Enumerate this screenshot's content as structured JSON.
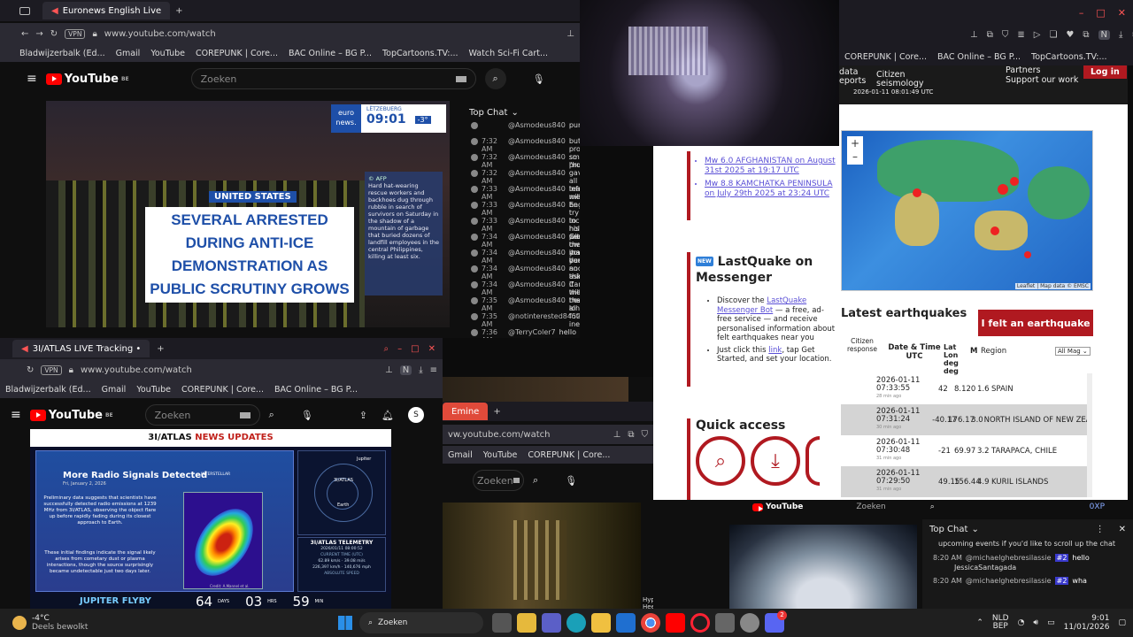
{
  "top_browser": {
    "tab_title": "Euronews English Live",
    "url": "www.youtube.com/watch",
    "vpn": "VPN",
    "bookmarks": [
      "Bladwijzerbalk (Ed...",
      "Gmail",
      "YouTube",
      "COREPUNK | Core...",
      "BAC Online – BG P...",
      "TopCartoons.TV:...",
      "Watch Sci-Fi Cart..."
    ],
    "yt_logo": "YouTube",
    "yt_region": "BE",
    "search_placeholder": "Zoeken"
  },
  "video_main": {
    "brand_top": "euro",
    "brand_bottom": "news.",
    "city": "LËTZEBUERG",
    "time": "09:01",
    "temp": "-3°",
    "tag": "UNITED STATES",
    "headline": "SEVERAL ARRESTED DURING ANTI-ICE DEMONSTRATION AS PUBLIC SCRUTINY GROWS",
    "side_source": "© AFP",
    "side_text": "Hard hat-wearing rescue workers and backhoes dug through rubble in search of survivors on Saturday in the shadow of a mountain of garbage that buried dozens of landfill employees in the central Philippines, killing at least six."
  },
  "chat_top": {
    "title": "Top Chat",
    "rows": [
      {
        "t": "",
        "u": "@Asmodeus840",
        "m": "purpose"
      },
      {
        "t": "7:32 AM",
        "u": "@Asmodeus840",
        "m": "but for problem so better \"humans\""
      },
      {
        "t": "7:32 AM",
        "u": "@Asmodeus840",
        "m": "smart problems"
      },
      {
        "t": "7:32 AM",
        "u": "@Asmodeus840",
        "m": "gave all info, will b"
      },
      {
        "t": "7:33 AM",
        "u": "@Asmodeus840",
        "m": "teach me English"
      },
      {
        "t": "7:33 AM",
        "u": "@Asmodeus840",
        "m": "he try to hold Cana"
      },
      {
        "t": "7:33 AM",
        "u": "@Asmodeus840",
        "m": "increase his presen there a make a deal"
      },
      {
        "t": "7:34 AM",
        "u": "@Asmodeus840",
        "m": "with owneing it as of you"
      },
      {
        "t": "7:34 AM",
        "u": "@Asmodeus840",
        "m": "you are humans no think"
      },
      {
        "t": "7:34 AM",
        "u": "@Asmodeus840",
        "m": "and ask if there ne"
      },
      {
        "t": "7:34 AM",
        "u": "@Asmodeus840",
        "m": "Canada will be the very long future it's inevitable"
      },
      {
        "t": "7:35 AM",
        "u": "@Asmodeus840",
        "m": "that's all"
      },
      {
        "t": "7:35 AM",
        "u": "@notinterested8452",
        "m": "USA gone rogu"
      },
      {
        "t": "7:36 AM",
        "u": "@TerryColer7",
        "m": "hello"
      }
    ]
  },
  "emsc": {
    "header_items": [
      "data",
      "Citizen",
      "seismology",
      "eports",
      "Partners",
      "Support our work"
    ],
    "header_time": "2026-01-11 08:01:49 UTC",
    "login": "Log in",
    "map_attribution": "Leaflet | Map data © EMSC",
    "zoom_in": "+",
    "zoom_out": "–",
    "latest_title": "Latest earthquakes",
    "felt_button": "I felt an earthquake",
    "col_citizen": "Citizen response",
    "col_date": "Date & Time UTC",
    "col_latlon": "Lat Lon deg deg",
    "col_mag": "M",
    "col_region": "Region",
    "filter": "All Mag",
    "rows": [
      {
        "date": "2026-01-11",
        "time": "07:33:55",
        "ago": "28 min ago",
        "lat": "42",
        "lon": "8.120",
        "mag": "1.6",
        "region": "SPAIN"
      },
      {
        "date": "2026-01-11",
        "time": "07:31:24",
        "ago": "30 min ago",
        "lat": "-40.17",
        "lon": "176.17",
        "mag": "3.0",
        "region": "NORTH ISLAND OF NEW ZEA..."
      },
      {
        "date": "2026-01-11",
        "time": "07:30:48",
        "ago": "31 min ago",
        "lat": "-21",
        "lon": "69.97",
        "mag": "3.2",
        "region": "TARAPACA, CHILE"
      },
      {
        "date": "2026-01-11",
        "time": "07:29:50",
        "ago": "31 min ago",
        "lat": "49.15",
        "lon": "156.44",
        "mag": "4.9",
        "region": "KURIL ISLANDS"
      }
    ]
  },
  "emsc_left": {
    "link1": "Mw 6.0 AFGHANISTAN on August 31st 2025 at 19:17 UTC",
    "link2": "Mw 8.8 KAMCHATKA PENINSULA on July 29th 2025 at 23:24 UTC",
    "lq_badge": "NEW",
    "lq_title": "LastQuake on Messenger",
    "lq_b1_pre": "Discover the ",
    "lq_b1_link": "LastQuake Messenger Bot",
    "lq_b1_post": " — a free, ad-free service — and receive personalised information about felt earthquakes near you",
    "lq_b2_pre": "Just click this ",
    "lq_b2_link": "link",
    "lq_b2_post": ", tap Get Started, and set your location.",
    "quick_title": "Quick access"
  },
  "right_browser": {
    "bookmarks": [
      "COREPUNK | Core...",
      "BAC Online – BG P...",
      "TopCartoons.TV:..."
    ]
  },
  "atlas_browser": {
    "tab_title": "3I/ATLAS LIVE Tracking •",
    "url": "www.youtube.com/watch",
    "bookmarks": [
      "Bladwijzerbalk (Ed...",
      "Gmail",
      "YouTube",
      "COREPUNK | Core...",
      "BAC Online – BG P..."
    ],
    "search_placeholder": "Zoeken",
    "avatar": "S",
    "banner": "3I/ATLAS",
    "banner_accent": "NEWS UPDATES",
    "card_title": "More Radio Signals Detected",
    "card_date": "Fri, January 2, 2026",
    "card_logo": "INTERSTELLAR",
    "card_p1": "Preliminary data suggests that scientists have successfully detected radio emissions at 1239 MHz from 3I/ATLAS, observing the object flare up before rapidly fading during its closest approach to Earth.",
    "card_p2": "These initial findings indicate the signal likely arises from cometary dust or plasma interactions, though the source surprisingly became undetectable just two days later.",
    "credit": "Credit: A.Mannel et al.",
    "orbit_jupiter": "Jupiter",
    "orbit_atlas": "3I/ATLAS",
    "orbit_earth": "Earth",
    "telemetry_title": "3I/ATLAS TELEMETRY",
    "telemetry_time": "2026/01/11 08:00:52",
    "telemetry_time_label": "CURRENT TIME (UTC)",
    "telemetry_speed1": "62.89 km/s",
    "telemetry_speed2": "226,397 km/h",
    "telemetry_speed3": "39.08 mi/s",
    "telemetry_speed4": "140,676 mph",
    "telemetry_speed_label": "ABSOLUTE SPEED",
    "flyby_label": "JUPITER FLYBY",
    "flyby_days": "64",
    "flyby_days_label": "DAYS",
    "flyby_hrs": "03",
    "flyby_hrs_label": "HRS",
    "flyby_min": "59",
    "flyby_min_label": "MIN"
  },
  "mini_browser": {
    "tab_title": "Emine",
    "url": "vw.youtube.com/watch",
    "bookmarks": [
      "Gmail",
      "YouTube",
      "COREPUNK | Core..."
    ],
    "search_placeholder": "Zoeken",
    "caption": "Hyperspace On Your Heels"
  },
  "chat_bottom": {
    "search": "Zoeken",
    "title": "Top Chat",
    "intro": "upcoming events if you'd like to scroll up the chat",
    "rows": [
      {
        "t": "8:20 AM",
        "u": "@michaelghebresilassie",
        "b": "#2",
        "m": "hello"
      },
      {
        "t": "",
        "u": "",
        "b": "",
        "m": "JessicaSantagada"
      },
      {
        "t": "8:20 AM",
        "u": "@michaelghebresilassie",
        "b": "#2",
        "m": "wha"
      }
    ],
    "badge_top": "0XP"
  },
  "taskbar": {
    "weather_temp": "-4°C",
    "weather_desc": "Deels bewolkt",
    "search": "Zoeken",
    "lang1": "NLD",
    "lang2": "BEP",
    "time": "9:01",
    "date": "11/01/2026",
    "discord_badge": "2"
  },
  "colors": {
    "yt_red": "#ff0000",
    "emsc_red": "#b01920",
    "euronews_blue": "#1e4fa8"
  }
}
